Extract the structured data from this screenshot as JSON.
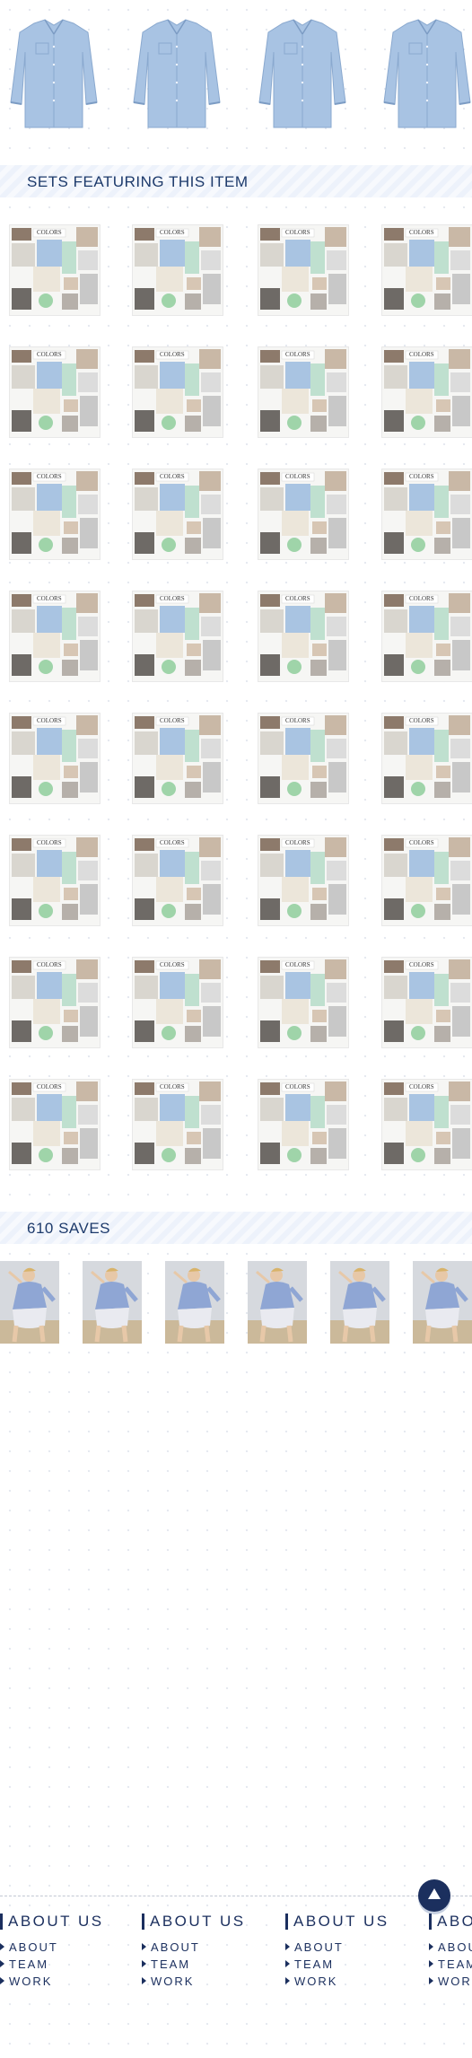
{
  "sets_section": {
    "title": "SETS FEATURING THIS ITEM"
  },
  "collage": {
    "label": "COLORS"
  },
  "saves_section": {
    "title": "610 SAVES"
  },
  "footer": {
    "columns": [
      {
        "heading": "ABOUT US",
        "links": [
          "ABOUT",
          "TEAM",
          "WORK"
        ]
      },
      {
        "heading": "ABOUT US",
        "links": [
          "ABOUT",
          "TEAM",
          "WORK"
        ]
      },
      {
        "heading": "ABOUT US",
        "links": [
          "ABOUT",
          "TEAM",
          "WORK"
        ]
      },
      {
        "heading": "ABOUT US",
        "links": [
          "ABOUT",
          "TEAM",
          "WORK"
        ]
      }
    ]
  },
  "colors": {
    "accent": "#1b2f5e",
    "shirt": "#a8c3e3",
    "section_bg": "#edf2fb"
  },
  "icons": {
    "back_to_top": "arrow-up-icon"
  }
}
